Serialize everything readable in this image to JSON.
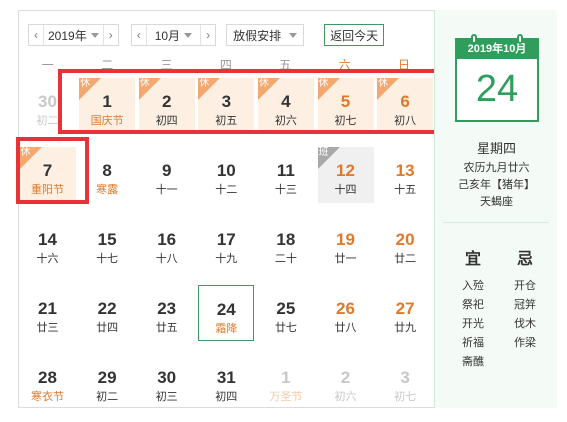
{
  "toolbar": {
    "prev_icon": "chevron-left-icon",
    "next_icon": "chevron-right-icon",
    "year": "2019年",
    "month": "10月",
    "holiday_select": "放假安排",
    "today_button": "返回今天"
  },
  "weekdays": [
    "一",
    "二",
    "三",
    "四",
    "五",
    "六",
    "日"
  ],
  "weeks": [
    [
      {
        "day": "30",
        "lunar": "初二",
        "type": "other"
      },
      {
        "day": "1",
        "lunar": "国庆节",
        "type": "holiday",
        "festival": true,
        "flag": "休"
      },
      {
        "day": "2",
        "lunar": "初四",
        "type": "holiday",
        "flag": "休"
      },
      {
        "day": "3",
        "lunar": "初五",
        "type": "holiday",
        "flag": "休"
      },
      {
        "day": "4",
        "lunar": "初六",
        "type": "holiday",
        "flag": "休"
      },
      {
        "day": "5",
        "lunar": "初七",
        "type": "holiday",
        "weekend": true,
        "flag": "休"
      },
      {
        "day": "6",
        "lunar": "初八",
        "type": "holiday",
        "weekend": true,
        "flag": "休"
      }
    ],
    [
      {
        "day": "7",
        "lunar": "重阳节",
        "type": "holiday",
        "festival": true,
        "flag": "休"
      },
      {
        "day": "8",
        "lunar": "寒露",
        "festival": true
      },
      {
        "day": "9",
        "lunar": "十一"
      },
      {
        "day": "10",
        "lunar": "十二"
      },
      {
        "day": "11",
        "lunar": "十三"
      },
      {
        "day": "12",
        "lunar": "十四",
        "type": "workday",
        "weekend": true,
        "flag": "班"
      },
      {
        "day": "13",
        "lunar": "十五",
        "weekend": true
      }
    ],
    [
      {
        "day": "14",
        "lunar": "十六"
      },
      {
        "day": "15",
        "lunar": "十七"
      },
      {
        "day": "16",
        "lunar": "十八"
      },
      {
        "day": "17",
        "lunar": "十九"
      },
      {
        "day": "18",
        "lunar": "二十"
      },
      {
        "day": "19",
        "lunar": "廿一",
        "weekend": true
      },
      {
        "day": "20",
        "lunar": "廿二",
        "weekend": true
      }
    ],
    [
      {
        "day": "21",
        "lunar": "廿三"
      },
      {
        "day": "22",
        "lunar": "廿四"
      },
      {
        "day": "23",
        "lunar": "廿五"
      },
      {
        "day": "24",
        "lunar": "霜降",
        "type": "today",
        "festival": true
      },
      {
        "day": "25",
        "lunar": "廿七"
      },
      {
        "day": "26",
        "lunar": "廿八",
        "weekend": true
      },
      {
        "day": "27",
        "lunar": "廿九",
        "weekend": true
      }
    ],
    [
      {
        "day": "28",
        "lunar": "寒衣节",
        "festival": true
      },
      {
        "day": "29",
        "lunar": "初二"
      },
      {
        "day": "30",
        "lunar": "初三"
      },
      {
        "day": "31",
        "lunar": "初四"
      },
      {
        "day": "1",
        "lunar": "万圣节",
        "type": "other",
        "festival": true
      },
      {
        "day": "2",
        "lunar": "初六",
        "type": "other"
      },
      {
        "day": "3",
        "lunar": "初七",
        "type": "other"
      }
    ]
  ],
  "side": {
    "icon_header": "2019年10月",
    "icon_day": "24",
    "weekday": "星期四",
    "lunar": "农历九月廿六",
    "ganzhi": "己亥年【猪年】",
    "zodiac": "天蝎座",
    "yi_title": "宜",
    "ji_title": "忌",
    "yi_items": [
      "入殓",
      "祭祀",
      "开光",
      "祈福",
      "斋醮"
    ],
    "ji_items": [
      "开仓",
      "冠笄",
      "伐木",
      "作梁"
    ]
  },
  "colors": {
    "accent_green": "#2f9e5d",
    "holiday_orange": "#e0792b",
    "highlight_red": "#e6333a"
  }
}
